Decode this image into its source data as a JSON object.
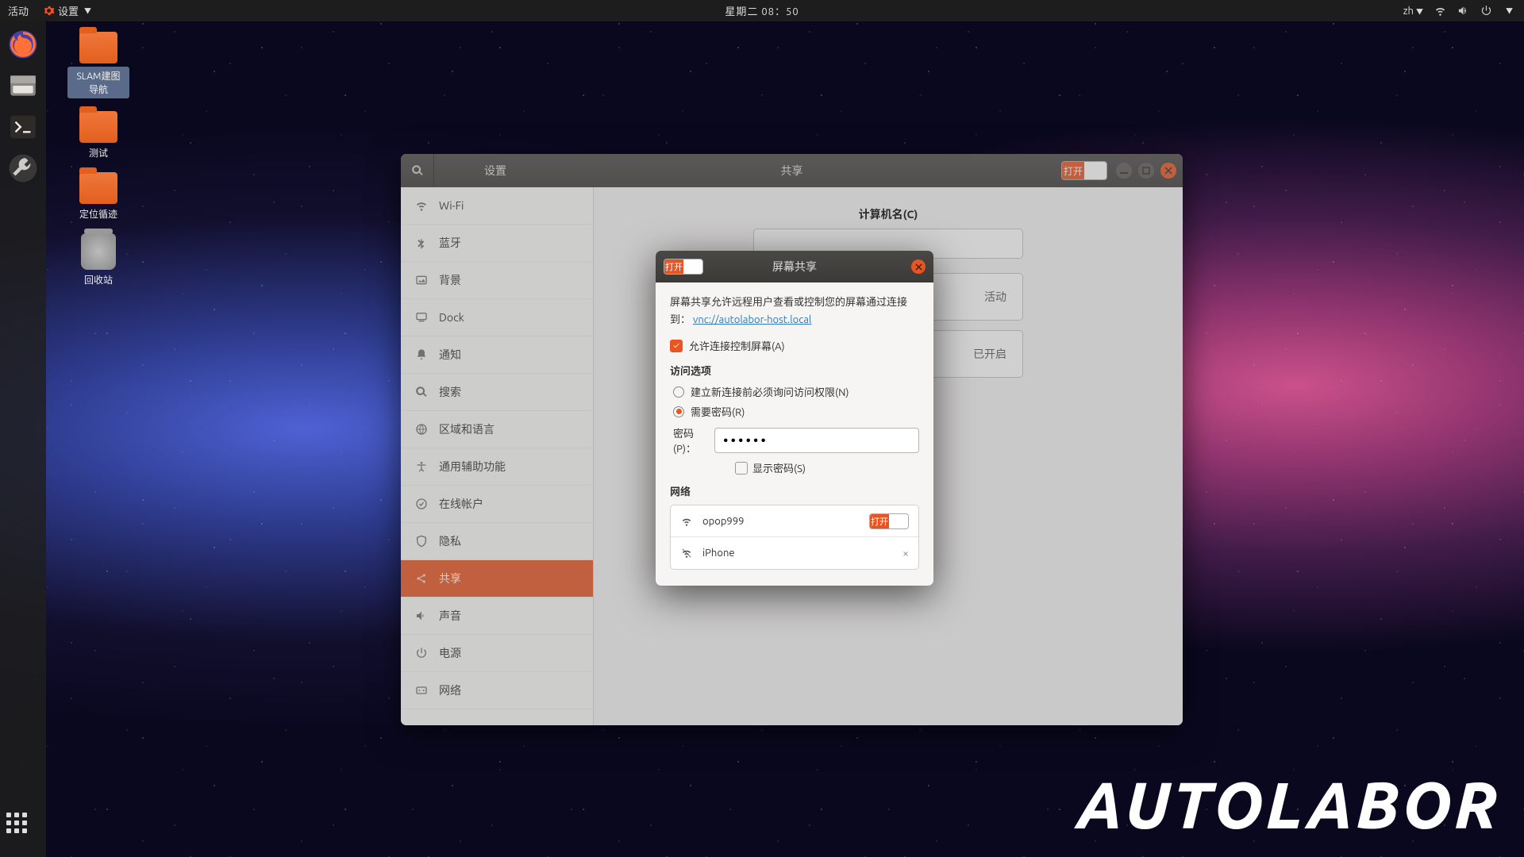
{
  "topbar": {
    "activities": "活动",
    "app_menu": "设置",
    "datetime": "星期二 08：50",
    "input_method": "zh"
  },
  "desktop": {
    "icons": [
      "SLAM建图导航",
      "测试",
      "定位循迹",
      "回收站"
    ],
    "watermark": "AUTOLABOR"
  },
  "settings_window": {
    "title_left": "设置",
    "title_center": "共享",
    "switch_label": "打开",
    "sidebar": [
      "Wi-Fi",
      "蓝牙",
      "背景",
      "Dock",
      "通知",
      "搜索",
      "区域和语言",
      "通用辅助功能",
      "在线帐户",
      "隐私",
      "共享",
      "声音",
      "电源",
      "网络"
    ],
    "active_index": 10,
    "content": {
      "computer_name_label": "计算机名(C)",
      "row1_status": "活动",
      "row2_status": "已开启"
    }
  },
  "dialog": {
    "switch_label": "打开",
    "title": "屏幕共享",
    "desc_prefix": "屏幕共享允许远程用户查看或控制您的屏幕通过连接到：",
    "vnc_link": "vnc://autolabor-host.local",
    "allow_control": "允许连接控制屏幕(A)",
    "access_header": "访问选项",
    "radio_ask": "建立新连接前必须询问访问权限(N)",
    "radio_pw": "需要密码(R)",
    "password_label": "密码(P)：",
    "password_value": "●●●●●●",
    "show_password": "显示密码(S)",
    "network_header": "网络",
    "networks": [
      {
        "name": "opop999",
        "on": true,
        "on_label": "打开"
      },
      {
        "name": "iPhone",
        "on": false
      }
    ]
  }
}
